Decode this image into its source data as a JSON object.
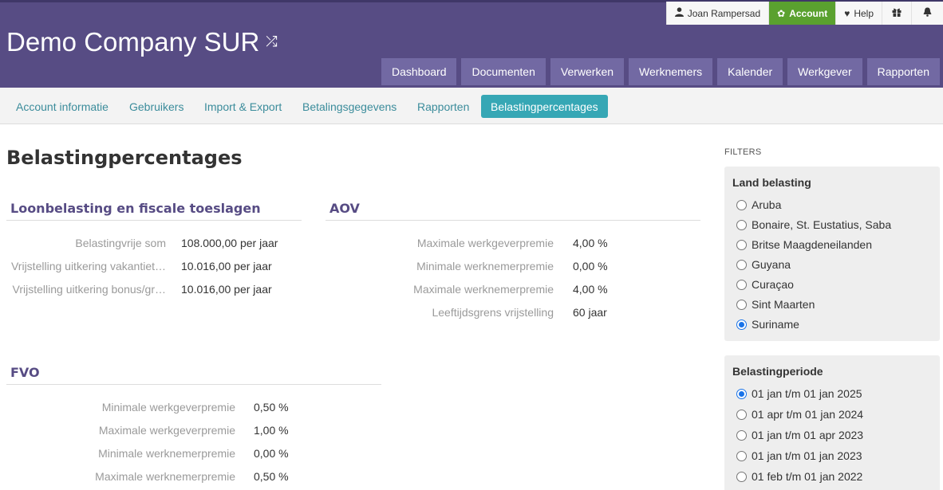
{
  "header": {
    "company": "Demo Company SUR",
    "shuffle_icon": "shuffle-icon",
    "top": {
      "user": "Joan Rampersad",
      "account": "Account",
      "help": "Help"
    },
    "nav": [
      "Dashboard",
      "Documenten",
      "Verwerken",
      "Werknemers",
      "Kalender",
      "Werkgever",
      "Rapporten"
    ]
  },
  "subnav": [
    "Account informatie",
    "Gebruikers",
    "Import & Export",
    "Betalingsgegevens",
    "Rapporten",
    "Belastingpercentages"
  ],
  "page_title": "Belastingpercentages",
  "loonbelasting": {
    "title": "Loonbelasting en fiscale toeslagen",
    "rows": [
      {
        "label": "Belastingvrije som",
        "value": "108.000,00 per jaar"
      },
      {
        "label": "Vrijstelling uitkering vakantiet…",
        "value": "10.016,00 per jaar"
      },
      {
        "label": "Vrijstelling uitkering bonus/gr…",
        "value": "10.016,00 per jaar"
      }
    ]
  },
  "aov": {
    "title": "AOV",
    "rows": [
      {
        "label": "Maximale werkgeverpremie",
        "value": "4,00 %"
      },
      {
        "label": "Minimale werknemerpremie",
        "value": "0,00 %"
      },
      {
        "label": "Maximale werknemerpremie",
        "value": "4,00 %"
      },
      {
        "label": "Leeftijdsgrens vrijstelling",
        "value": "60 jaar"
      }
    ]
  },
  "fvo": {
    "title": "FVO",
    "rows": [
      {
        "label": "Minimale werkgeverpremie",
        "value": "0,50 %"
      },
      {
        "label": "Maximale werkgeverpremie",
        "value": "1,00 %"
      },
      {
        "label": "Minimale werknemerpremie",
        "value": "0,00 %"
      },
      {
        "label": "Maximale werknemerpremie",
        "value": "0,50 %"
      }
    ]
  },
  "filters": {
    "title": "FILTERS",
    "land": {
      "title": "Land belasting",
      "options": [
        "Aruba",
        "Bonaire, St. Eustatius, Saba",
        "Britse Maagdeneilanden",
        "Guyana",
        "Curaçao",
        "Sint Maarten",
        "Suriname"
      ],
      "selected": "Suriname"
    },
    "periode": {
      "title": "Belastingperiode",
      "options": [
        "01 jan t/m 01 jan 2025",
        "01 apr t/m 01 jan 2024",
        "01 jan t/m 01 apr 2023",
        "01 jan t/m 01 jan 2023",
        "01 feb t/m 01 jan 2022"
      ],
      "selected": "01 jan t/m 01 jan 2025"
    }
  },
  "colors": {
    "header": "#574c84",
    "nav_button": "#7269a3",
    "account": "#5aa12f",
    "subnav_active": "#36a7b5"
  }
}
